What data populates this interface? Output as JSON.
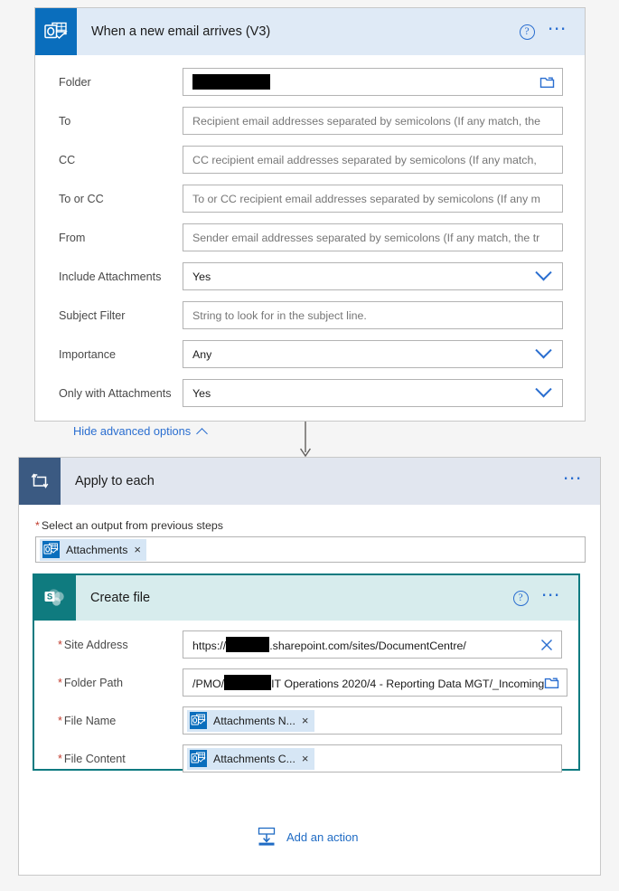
{
  "trigger": {
    "title": "When a new email arrives (V3)",
    "icon": "outlook-icon",
    "help_icon": "help-icon",
    "more_icon": "more-options-icon",
    "accent": "#0a6ebd",
    "header_bg": "#dfeaf6",
    "fields": [
      {
        "label": "Folder",
        "type": "redacted",
        "value": "",
        "redact_width": 86,
        "icon": "folder-picker-icon"
      },
      {
        "label": "To",
        "type": "placeholder",
        "value": "Recipient email addresses separated by semicolons (If any match, the",
        "icon": ""
      },
      {
        "label": "CC",
        "type": "placeholder",
        "value": "CC recipient email addresses separated by semicolons (If any match, ",
        "icon": ""
      },
      {
        "label": "To or CC",
        "type": "placeholder",
        "value": "To or CC recipient email addresses separated by semicolons (If any m",
        "icon": ""
      },
      {
        "label": "From",
        "type": "placeholder",
        "value": "Sender email addresses separated by semicolons (If any match, the tr",
        "icon": ""
      },
      {
        "label": "Include Attachments",
        "type": "dropdown",
        "value": "Yes",
        "icon": "chevron-down-icon"
      },
      {
        "label": "Subject Filter",
        "type": "placeholder",
        "value": "String to look for in the subject line.",
        "icon": ""
      },
      {
        "label": "Importance",
        "type": "dropdown",
        "value": "Any",
        "icon": "chevron-down-icon"
      },
      {
        "label": "Only with Attachments",
        "type": "dropdown",
        "value": "Yes",
        "icon": "chevron-down-icon"
      }
    ],
    "advanced_link": "Hide advanced options"
  },
  "loop": {
    "title": "Apply to each",
    "icon": "loop-icon",
    "more_icon": "more-options-icon",
    "header_bg": "#e1e6ef",
    "accent": "#3b5a82",
    "select_output_label": "Select an output from previous steps",
    "required_marker": "*",
    "token": {
      "label": "Attachments",
      "icon": "outlook-icon",
      "remove": "×"
    }
  },
  "create_file": {
    "title": "Create file",
    "icon": "sharepoint-icon",
    "help_icon": "help-icon",
    "more_icon": "more-options-icon",
    "border_color": "#0b7a80",
    "header_bg": "#d7eced",
    "accent": "#0f7b7f",
    "fields": [
      {
        "label": "Site Address",
        "required": true,
        "type": "text-redacted",
        "prefix": "https://",
        "redact_width": 48,
        "suffix": ".sharepoint.com/sites/DocumentCentre/",
        "icon": "clear-icon"
      },
      {
        "label": "Folder Path",
        "required": true,
        "type": "text-redacted",
        "prefix": "/PMO/",
        "redact_width": 52,
        "suffix": "IT Operations 2020/4 - Reporting Data MGT/_Incoming",
        "icon": "folder-picker-icon"
      },
      {
        "label": "File Name",
        "required": true,
        "type": "token",
        "token_label": "Attachments N...",
        "token_icon": "outlook-icon",
        "remove": "×"
      },
      {
        "label": "File Content",
        "required": true,
        "type": "token",
        "token_label": "Attachments C...",
        "token_icon": "outlook-icon",
        "remove": "×"
      }
    ]
  },
  "add_action": {
    "label": "Add an action",
    "icon": "insert-down-icon"
  }
}
